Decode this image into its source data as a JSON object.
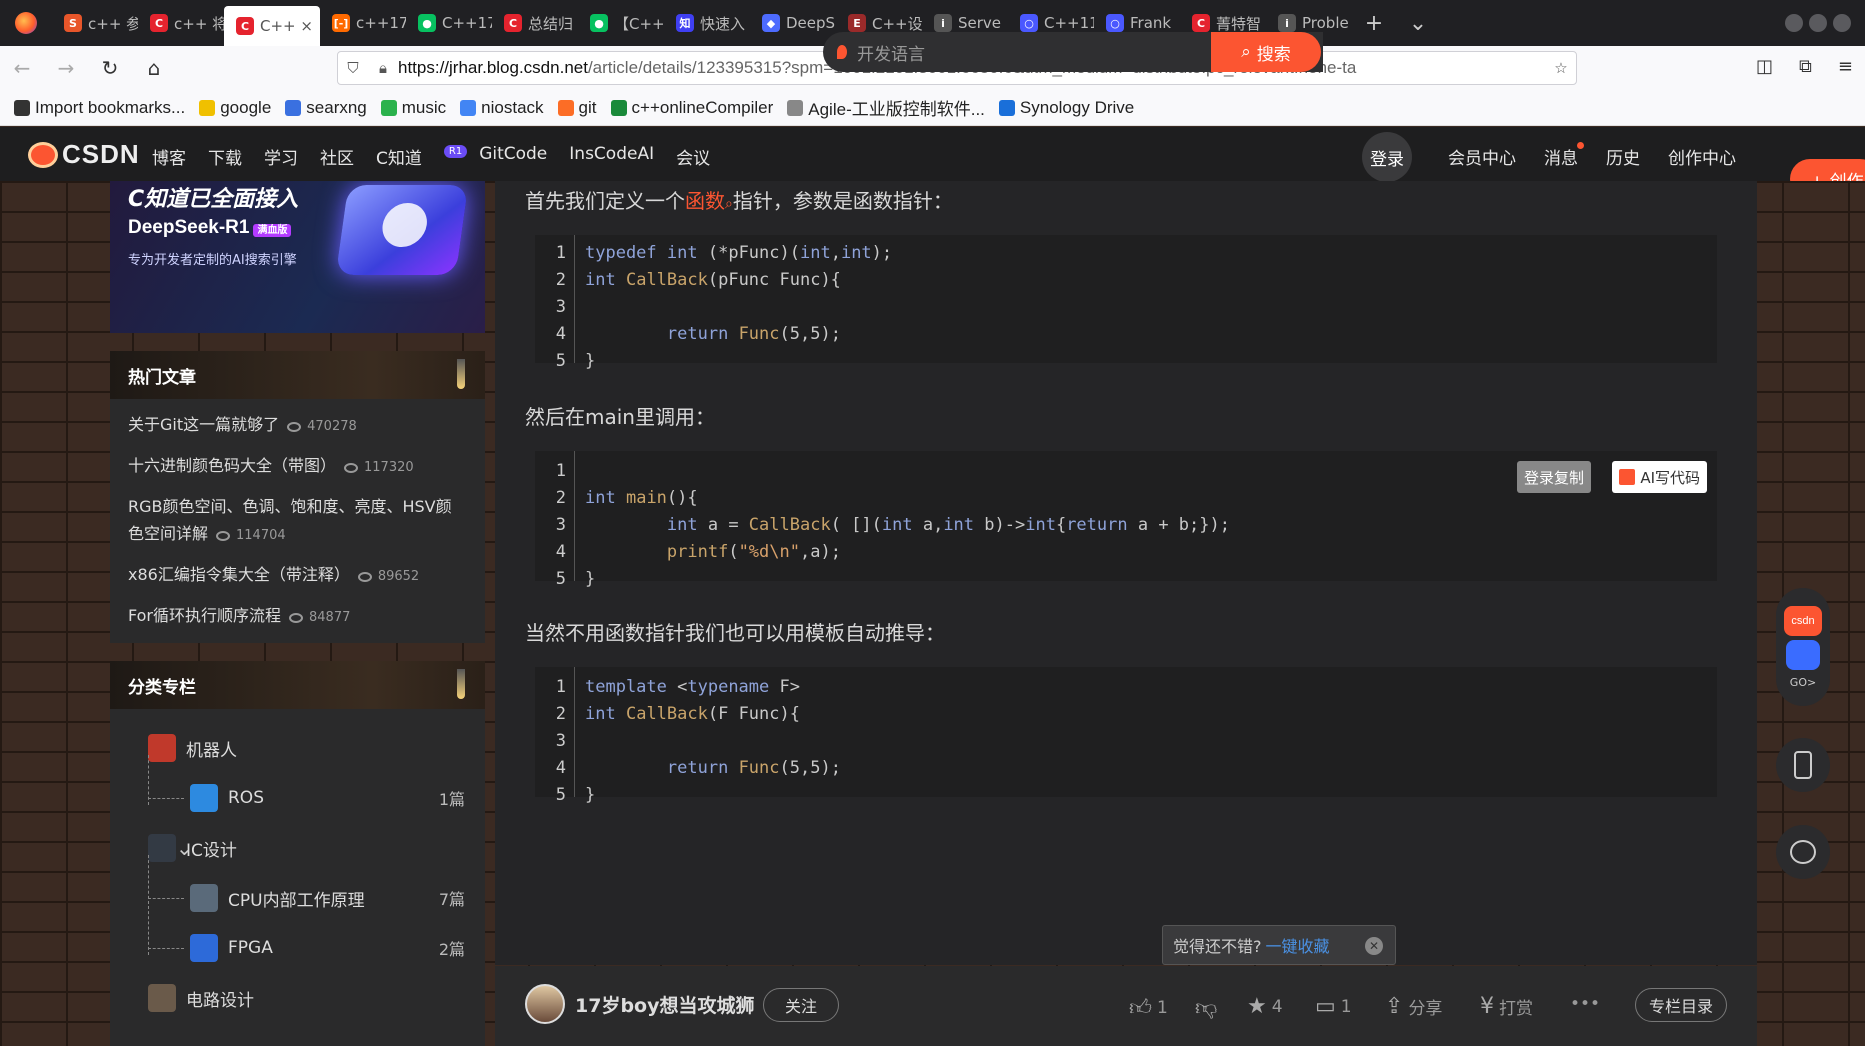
{
  "browser": {
    "tabs": [
      {
        "title": "c++ 参",
        "fav": "S",
        "fav_color": "#e8562a"
      },
      {
        "title": "c++ 将",
        "fav": "C",
        "fav_color": "#e5232e"
      },
      {
        "title": "C++ ×",
        "fav": "C",
        "fav_color": "#e5232e"
      },
      {
        "title": "c++17",
        "fav": "[-]",
        "fav_color": "#ff6a00"
      },
      {
        "title": "C++17",
        "fav": "●",
        "fav_color": "#07c160"
      },
      {
        "title": "总结归",
        "fav": "C",
        "fav_color": "#e5232e"
      },
      {
        "title": "【C++",
        "fav": "●",
        "fav_color": "#07c160"
      },
      {
        "title": "快速入",
        "fav": "知",
        "fav_color": "#3f3ff2"
      },
      {
        "title": "DeepS",
        "fav": "◆",
        "fav_color": "#4d6bfe"
      },
      {
        "title": "C++设",
        "fav": "E",
        "fav_color": "#9a2a2a"
      },
      {
        "title": "Serve",
        "fav": "i",
        "fav_color": "#555555"
      },
      {
        "title": "C++11",
        "fav": "○",
        "fav_color": "#4a58ff"
      },
      {
        "title": "Frank",
        "fav": "○",
        "fav_color": "#4a58ff"
      },
      {
        "title": "菁特智",
        "fav": "C",
        "fav_color": "#e5232e"
      },
      {
        "title": "Proble",
        "fav": "i",
        "fav_color": "#555555"
      }
    ],
    "active_tab_title": "C++",
    "url_host": "https://jrhar.blog.csdn.net",
    "url_path": "/article/details/123395315?spm=1001.2101.3001.6650.6&utm_medium=distribute.pc_relevant.none-ta",
    "bookmarks": [
      {
        "label": "Import bookmarks...",
        "icon": "import-icon",
        "color": "#333333"
      },
      {
        "label": "google",
        "icon": "lock-icon",
        "color": "#f0c000"
      },
      {
        "label": "searxng",
        "icon": "search-icon",
        "color": "#3a70e0"
      },
      {
        "label": "music",
        "icon": "music-icon",
        "color": "#2bb24c"
      },
      {
        "label": "niostack",
        "icon": "google-icon",
        "color": "#4285f4"
      },
      {
        "label": "git",
        "icon": "gitlab-icon",
        "color": "#fc6d26"
      },
      {
        "label": "c++onlineCompiler",
        "icon": "w-icon",
        "color": "#1a8a3a"
      },
      {
        "label": "Agile-工业版控制软件...",
        "icon": "spinner-icon",
        "color": "#888888"
      },
      {
        "label": "Synology Drive",
        "icon": "dsm-icon",
        "color": "#1a6fd9"
      }
    ]
  },
  "csdn": {
    "logo_text": "CSDN",
    "nav": [
      "博客",
      "下载",
      "学习",
      "社区",
      "C知道",
      "GitCode",
      "InsCodeAI",
      "会议"
    ],
    "r1_badge": "R1",
    "search_placeholder": "开发语言",
    "search_button": "搜索",
    "login": "登录",
    "right_nav": [
      "会员中心",
      "消息",
      "历史",
      "创作中心"
    ],
    "create_button": "+ 创作"
  },
  "sidebar": {
    "banner": {
      "line1": "C知道已全面接入",
      "line2": "DeepSeek-R1",
      "line2_badge": "满血版",
      "line3": "专为开发者定制的AI搜索引擎"
    },
    "hot_title": "热门文章",
    "hot_articles": [
      {
        "title": "关于Git这一篇就够了",
        "views": "470278"
      },
      {
        "title": "十六进制颜色码大全（带图）",
        "views": "117320"
      },
      {
        "title": "RGB颜色空间、色调、饱和度、亮度、HSV颜色空间详解",
        "views": "114704"
      },
      {
        "title": "x86汇编指令集大全（带注释）",
        "views": "89652"
      },
      {
        "title": "For循环执行顺序流程",
        "views": "84877"
      }
    ],
    "cat_title": "分类专栏",
    "categories": [
      {
        "name": "机器人",
        "level": "top",
        "count": "",
        "color": "#c0392b"
      },
      {
        "name": "ROS",
        "level": "sub",
        "count": "1篇",
        "color": "#2d8ae0"
      },
      {
        "name": "IC设计",
        "level": "top",
        "count": "",
        "color": "#333a44"
      },
      {
        "name": "CPU内部工作原理",
        "level": "sub",
        "count": "7篇",
        "color": "#5a6a7a"
      },
      {
        "name": "FPGA",
        "level": "sub",
        "count": "2篇",
        "color": "#2d6ad9"
      },
      {
        "name": "电路设计",
        "level": "top",
        "count": "",
        "color": "#6a5a4a"
      }
    ]
  },
  "article": {
    "p1_before": "首先我们定义一个",
    "p1_link": "函数",
    "p1_after": "指针，参数是函数指针：",
    "code1_lines": [
      "1",
      "2",
      "3",
      "4",
      "5"
    ],
    "p2": "然后在main里调用：",
    "code2_lines": [
      "1",
      "2",
      "3",
      "4",
      "5"
    ],
    "copy_button": "登录复制",
    "ai_button": "AI写代码",
    "p3": "当然不用函数指针我们也可以用模板自动推导：",
    "code3_lines": [
      "1",
      "2",
      "3",
      "4",
      "5"
    ]
  },
  "toast": {
    "text": "觉得还不错?",
    "link": "一键收藏"
  },
  "toolbar": {
    "author": "17岁boy想当攻城狮",
    "follow": "关注",
    "likes": "1",
    "stars": "4",
    "comments": "1",
    "share": "分享",
    "reward": "打赏",
    "more": "•••",
    "column_dir": "专栏目录"
  },
  "float": {
    "csdn_label": "csdn",
    "go_label": "GO>"
  }
}
